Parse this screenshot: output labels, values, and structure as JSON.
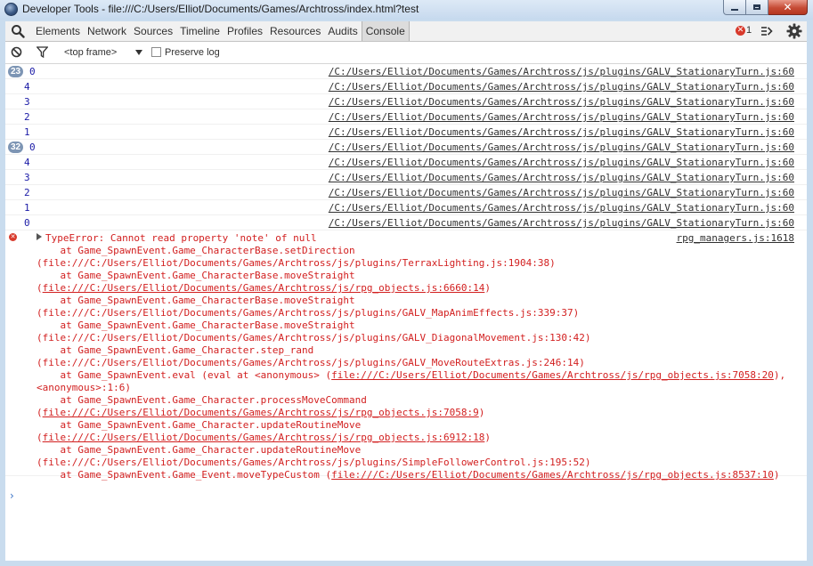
{
  "window": {
    "title": "Developer Tools - file:///C:/Users/Elliot/Documents/Games/Archtross/index.html?test",
    "close_glyph": "✕"
  },
  "tabs": [
    "Elements",
    "Network",
    "Sources",
    "Timeline",
    "Profiles",
    "Resources",
    "Audits",
    "Console"
  ],
  "active_tab": "Console",
  "toolbar": {
    "error_count": "1"
  },
  "filter_bar": {
    "frame_label": "<top frame>",
    "preserve_log_label": "Preserve log"
  },
  "log_rows": [
    {
      "badge": "23",
      "value": "0",
      "source": "/C:/Users/Elliot/Documents/Games/Archtross/js/plugins/GALV_StationaryTurn.js:60"
    },
    {
      "badge": "",
      "value": "4",
      "source": "/C:/Users/Elliot/Documents/Games/Archtross/js/plugins/GALV_StationaryTurn.js:60"
    },
    {
      "badge": "",
      "value": "3",
      "source": "/C:/Users/Elliot/Documents/Games/Archtross/js/plugins/GALV_StationaryTurn.js:60"
    },
    {
      "badge": "",
      "value": "2",
      "source": "/C:/Users/Elliot/Documents/Games/Archtross/js/plugins/GALV_StationaryTurn.js:60"
    },
    {
      "badge": "",
      "value": "1",
      "source": "/C:/Users/Elliot/Documents/Games/Archtross/js/plugins/GALV_StationaryTurn.js:60"
    },
    {
      "badge": "32",
      "value": "0",
      "source": "/C:/Users/Elliot/Documents/Games/Archtross/js/plugins/GALV_StationaryTurn.js:60"
    },
    {
      "badge": "",
      "value": "4",
      "source": "/C:/Users/Elliot/Documents/Games/Archtross/js/plugins/GALV_StationaryTurn.js:60"
    },
    {
      "badge": "",
      "value": "3",
      "source": "/C:/Users/Elliot/Documents/Games/Archtross/js/plugins/GALV_StationaryTurn.js:60"
    },
    {
      "badge": "",
      "value": "2",
      "source": "/C:/Users/Elliot/Documents/Games/Archtross/js/plugins/GALV_StationaryTurn.js:60"
    },
    {
      "badge": "",
      "value": "1",
      "source": "/C:/Users/Elliot/Documents/Games/Archtross/js/plugins/GALV_StationaryTurn.js:60"
    },
    {
      "badge": "",
      "value": "0",
      "source": "/C:/Users/Elliot/Documents/Games/Archtross/js/plugins/GALV_StationaryTurn.js:60"
    }
  ],
  "error": {
    "message": "TypeError: Cannot read property 'note' of null",
    "source": "rpg_managers.js:1618",
    "stack_lines": [
      [
        {
          "t": "    at Game_SpawnEvent.Game_CharacterBase.setDirection"
        }
      ],
      [
        {
          "t": "(file:///C:/Users/Elliot/Documents/Games/Archtross/js/plugins/TerraxLighting.js:1904:38)"
        }
      ],
      [
        {
          "t": "    at Game_SpawnEvent.Game_CharacterBase.moveStraight"
        }
      ],
      [
        {
          "t": "("
        },
        {
          "t": "file:///C:/Users/Elliot/Documents/Games/Archtross/js/rpg_objects.js:6660:14",
          "link": true
        },
        {
          "t": ")"
        }
      ],
      [
        {
          "t": "    at Game_SpawnEvent.Game_CharacterBase.moveStraight"
        }
      ],
      [
        {
          "t": "(file:///C:/Users/Elliot/Documents/Games/Archtross/js/plugins/GALV_MapAnimEffects.js:339:37)"
        }
      ],
      [
        {
          "t": "    at Game_SpawnEvent.Game_CharacterBase.moveStraight"
        }
      ],
      [
        {
          "t": "(file:///C:/Users/Elliot/Documents/Games/Archtross/js/plugins/GALV_DiagonalMovement.js:130:42)"
        }
      ],
      [
        {
          "t": "    at Game_SpawnEvent.Game_Character.step_rand"
        }
      ],
      [
        {
          "t": "(file:///C:/Users/Elliot/Documents/Games/Archtross/js/plugins/GALV_MoveRouteExtras.js:246:14)"
        }
      ],
      [
        {
          "t": "    at Game_SpawnEvent.eval (eval at <anonymous> ("
        },
        {
          "t": "file:///C:/Users/Elliot/Documents/Games/Archtross/js/rpg_objects.js:7058:20",
          "link": true
        },
        {
          "t": "),"
        }
      ],
      [
        {
          "t": "<anonymous>:1:6)"
        }
      ],
      [
        {
          "t": "    at Game_SpawnEvent.Game_Character.processMoveCommand"
        }
      ],
      [
        {
          "t": "("
        },
        {
          "t": "file:///C:/Users/Elliot/Documents/Games/Archtross/js/rpg_objects.js:7058:9",
          "link": true
        },
        {
          "t": ")"
        }
      ],
      [
        {
          "t": "    at Game_SpawnEvent.Game_Character.updateRoutineMove"
        }
      ],
      [
        {
          "t": "("
        },
        {
          "t": "file:///C:/Users/Elliot/Documents/Games/Archtross/js/rpg_objects.js:6912:18",
          "link": true
        },
        {
          "t": ")"
        }
      ],
      [
        {
          "t": "    at Game_SpawnEvent.Game_Character.updateRoutineMove"
        }
      ],
      [
        {
          "t": "(file:///C:/Users/Elliot/Documents/Games/Archtross/js/plugins/SimpleFollowerControl.js:195:52)"
        }
      ],
      [
        {
          "t": "    at Game_SpawnEvent.Game_Event.moveTypeCustom ("
        },
        {
          "t": "file:///C:/Users/Elliot/Documents/Games/Archtross/js/rpg_objects.js:8537:10",
          "link": true
        },
        {
          "t": ")"
        }
      ]
    ]
  },
  "console_prompt": "›"
}
